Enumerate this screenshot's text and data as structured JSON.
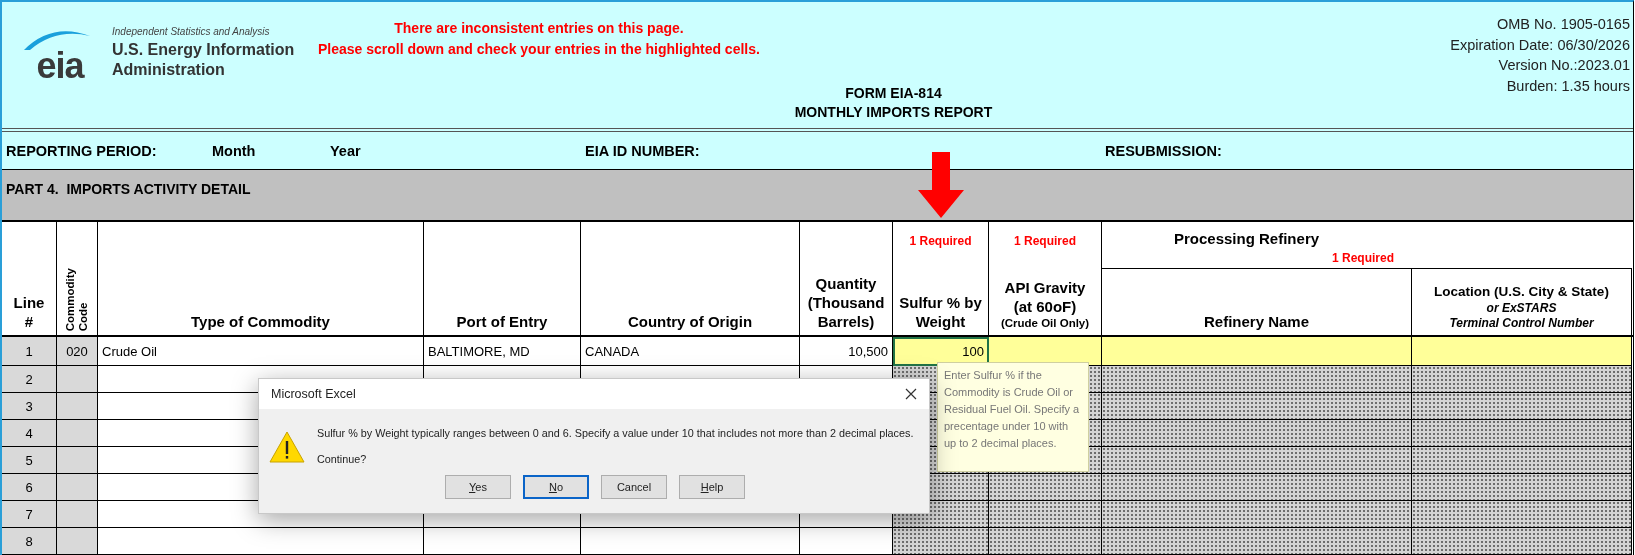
{
  "header": {
    "logo": {
      "mark": "eia",
      "tagline": "Independent Statistics and Analysis",
      "name_lines": [
        "U.S. Energy Information",
        "Administration"
      ]
    },
    "alert_lines": [
      "There are inconsistent entries on this page.",
      "Please scroll down and check your entries in the highlighted cells."
    ],
    "form_title": "FORM EIA-814",
    "form_subtitle": "MONTHLY IMPORTS REPORT",
    "omb_lines": [
      "OMB No. 1905-0165",
      "Expiration Date: 06/30/2026",
      "Version No.:2023.01",
      "Burden: 1.35 hours"
    ]
  },
  "reporting_row": [
    "REPORTING PERIOD:",
    "Month",
    "Year",
    "EIA ID NUMBER:",
    "RESUBMISSION:"
  ],
  "part_title": "PART 4.  IMPORTS ACTIVITY DETAIL",
  "table": {
    "columns": [
      {
        "label": "Line\n#",
        "kind": "line"
      },
      {
        "label": "Commodity\nCode",
        "kind": "code"
      },
      {
        "label": "Type of Commodity",
        "kind": "text"
      },
      {
        "label": "Port of Entry",
        "kind": "text"
      },
      {
        "label": "Country of Origin",
        "kind": "text"
      },
      {
        "label": "Quantity\n(Thousand\nBarrels)",
        "kind": "number"
      },
      {
        "label": "Sulfur % by\nWeight",
        "kind": "checked",
        "required": "1 Required"
      },
      {
        "label": "API Gravity\n(at 60oF)",
        "kind": "checked",
        "required": "1 Required",
        "note": "(Crude Oil Only)",
        "note_italic": false
      }
    ],
    "group": {
      "title": "Processing Refinery",
      "required": "1 Required",
      "columns": [
        {
          "label": "Refinery Name",
          "kind": "checked"
        },
        {
          "label": "Location (U.S. City & State)",
          "kind": "checked",
          "note": "or ExSTARS\nTerminal Control Number",
          "note_italic": true
        }
      ]
    },
    "rows": [
      {
        "line": "1",
        "highlighted": true,
        "cells": [
          {
            "text": "020",
            "selected": false
          },
          {
            "text": "Crude Oil",
            "selected": false
          },
          {
            "text": "BALTIMORE, MD",
            "selected": false
          },
          {
            "text": "CANADA",
            "selected": false
          },
          {
            "text": "10,500",
            "selected": false
          },
          {
            "text": "100",
            "selected": true
          },
          {
            "selected": false
          },
          {
            "selected": false
          },
          {
            "selected": false
          }
        ]
      },
      {
        "line": "2",
        "highlighted": false
      },
      {
        "line": "3",
        "highlighted": false
      },
      {
        "line": "4",
        "highlighted": false
      },
      {
        "line": "5",
        "highlighted": false
      },
      {
        "line": "6",
        "highlighted": false
      },
      {
        "line": "7",
        "highlighted": false
      },
      {
        "line": "8",
        "highlighted": false
      }
    ]
  },
  "tooltip": "Enter Sulfur % if the Commodity is Crude Oil or Residual Fuel Oil.   Specify a precentage under 10 with up to 2 decimal places.",
  "dialog": {
    "title": "Microsoft Excel",
    "message": "Sulfur % by Weight typically ranges between 0 and 6.  Specify a value under 10 that includes not more than 2 decimal places.",
    "question": "Continue?",
    "buttons": [
      {
        "label": "Yes",
        "underline_first": true,
        "focused": false
      },
      {
        "label": "No",
        "underline_first": true,
        "focused": true
      },
      {
        "label": "Cancel",
        "underline_first": false,
        "focused": false
      },
      {
        "label": "Help",
        "underline_first": true,
        "focused": false
      }
    ]
  }
}
